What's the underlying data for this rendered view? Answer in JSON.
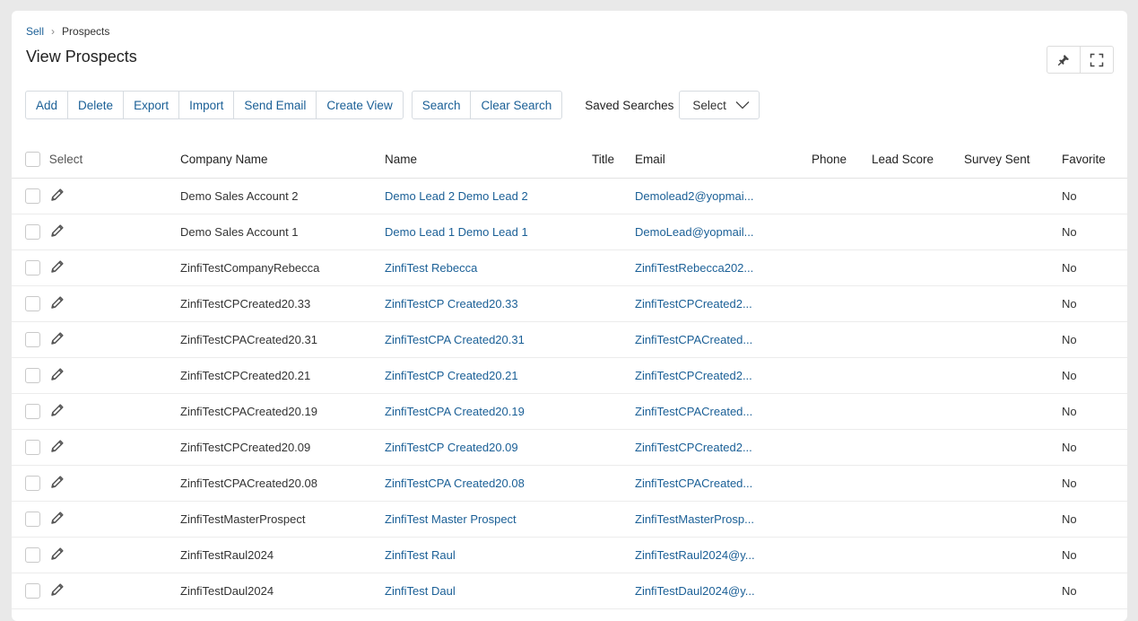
{
  "breadcrumb": {
    "parent": "Sell",
    "current": "Prospects"
  },
  "page": {
    "title": "View Prospects"
  },
  "toolbar": {
    "actions": [
      "Add",
      "Delete",
      "Export",
      "Import",
      "Send Email",
      "Create View"
    ],
    "search": [
      "Search",
      "Clear Search"
    ],
    "saved_searches_label": "Saved Searches",
    "saved_searches_value": "Select"
  },
  "table": {
    "select_label": "Select",
    "columns": [
      "Company Name",
      "Name",
      "Title",
      "Email",
      "Phone",
      "Lead Score",
      "Survey Sent",
      "Favorite"
    ],
    "rows": [
      {
        "company": "Demo Sales Account 2",
        "name": "Demo Lead 2 Demo Lead 2",
        "title": "",
        "email": "Demolead2@yopmai...",
        "phone": "",
        "lead_score": "",
        "survey_sent": "",
        "favorite": "No"
      },
      {
        "company": "Demo Sales Account 1",
        "name": "Demo Lead 1 Demo Lead 1",
        "title": "",
        "email": "DemoLead@yopmail...",
        "phone": "",
        "lead_score": "",
        "survey_sent": "",
        "favorite": "No"
      },
      {
        "company": "ZinfiTestCompanyRebecca",
        "name": "ZinfiTest Rebecca",
        "title": "",
        "email": "ZinfiTestRebecca202...",
        "phone": "",
        "lead_score": "",
        "survey_sent": "",
        "favorite": "No"
      },
      {
        "company": "ZinfiTestCPCreated20.33",
        "name": "ZinfiTestCP Created20.33",
        "title": "",
        "email": "ZinfiTestCPCreated2...",
        "phone": "",
        "lead_score": "",
        "survey_sent": "",
        "favorite": "No"
      },
      {
        "company": "ZinfiTestCPACreated20.31",
        "name": "ZinfiTestCPA Created20.31",
        "title": "",
        "email": "ZinfiTestCPACreated...",
        "phone": "",
        "lead_score": "",
        "survey_sent": "",
        "favorite": "No"
      },
      {
        "company": "ZinfiTestCPCreated20.21",
        "name": "ZinfiTestCP Created20.21",
        "title": "",
        "email": "ZinfiTestCPCreated2...",
        "phone": "",
        "lead_score": "",
        "survey_sent": "",
        "favorite": "No"
      },
      {
        "company": "ZinfiTestCPACreated20.19",
        "name": "ZinfiTestCPA Created20.19",
        "title": "",
        "email": "ZinfiTestCPACreated...",
        "phone": "",
        "lead_score": "",
        "survey_sent": "",
        "favorite": "No"
      },
      {
        "company": "ZinfiTestCPCreated20.09",
        "name": "ZinfiTestCP Created20.09",
        "title": "",
        "email": "ZinfiTestCPCreated2...",
        "phone": "",
        "lead_score": "",
        "survey_sent": "",
        "favorite": "No"
      },
      {
        "company": "ZinfiTestCPACreated20.08",
        "name": "ZinfiTestCPA Created20.08",
        "title": "",
        "email": "ZinfiTestCPACreated...",
        "phone": "",
        "lead_score": "",
        "survey_sent": "",
        "favorite": "No"
      },
      {
        "company": "ZinfiTestMasterProspect",
        "name": "ZinfiTest Master Prospect",
        "title": "",
        "email": "ZinfiTestMasterProsp...",
        "phone": "",
        "lead_score": "",
        "survey_sent": "",
        "favorite": "No"
      },
      {
        "company": "ZinfiTestRaul2024",
        "name": "ZinfiTest Raul",
        "title": "",
        "email": "ZinfiTestRaul2024@y...",
        "phone": "",
        "lead_score": "",
        "survey_sent": "",
        "favorite": "No"
      },
      {
        "company": "ZinfiTestDaul2024",
        "name": "ZinfiTest Daul",
        "title": "",
        "email": "ZinfiTestDaul2024@y...",
        "phone": "",
        "lead_score": "",
        "survey_sent": "",
        "favorite": "No"
      }
    ]
  },
  "icons": {
    "pin": "pin-icon",
    "fullscreen": "fullscreen-icon",
    "edit": "pencil-icon",
    "dropdown": "chevron-down-icon"
  },
  "colors": {
    "link": "#1a5f96",
    "background": "#e9e9e9",
    "card": "#ffffff"
  }
}
